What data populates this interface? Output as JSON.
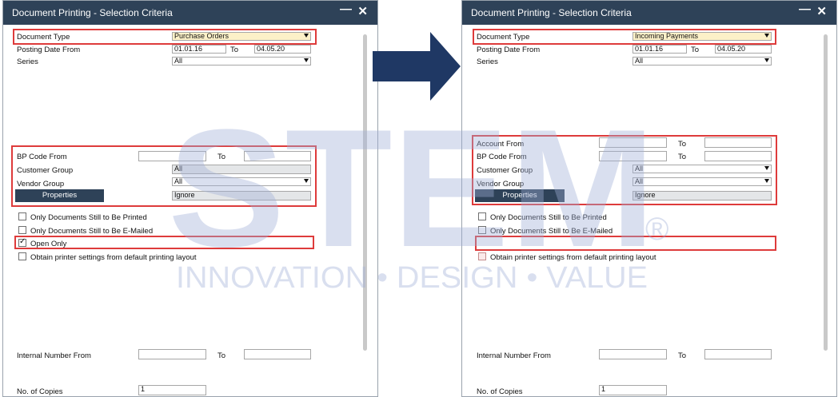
{
  "windows": [
    {
      "title": "Document Printing - Selection Criteria",
      "document_type": {
        "label": "Document Type",
        "value": "Purchase Orders"
      },
      "posting_date": {
        "label": "Posting Date From",
        "from": "01.01.16",
        "to_label": "To",
        "to": "04.05.20"
      },
      "series": {
        "label": "Series",
        "value": "All"
      },
      "account_from": null,
      "bp_code": {
        "label": "BP Code From",
        "from": "",
        "to_label": "To",
        "to": ""
      },
      "customer_group": {
        "label": "Customer Group",
        "value": "All"
      },
      "vendor_group": {
        "label": "Vendor Group",
        "value": "All"
      },
      "properties": {
        "button": "Properties",
        "value": "Ignore"
      },
      "checks": [
        {
          "label": "Only Documents Still to Be Printed",
          "checked": false
        },
        {
          "label": "Only Documents Still to Be E-Mailed",
          "checked": false
        },
        {
          "label": "Open Only",
          "checked": true
        },
        {
          "label": "Obtain printer settings from default printing layout",
          "checked": false
        }
      ],
      "internal_number": {
        "label": "Internal Number From",
        "from": "",
        "to_label": "To",
        "to": ""
      },
      "copies": {
        "label": "No. of Copies",
        "value": "1"
      }
    },
    {
      "title": "Document Printing - Selection Criteria",
      "document_type": {
        "label": "Document Type",
        "value": "Incoming Payments"
      },
      "posting_date": {
        "label": "Posting Date From",
        "from": "01.01.16",
        "to_label": "To",
        "to": "04.05.20"
      },
      "series": {
        "label": "Series",
        "value": "All"
      },
      "account_from": {
        "label": "Account From",
        "from": "",
        "to_label": "To",
        "to": ""
      },
      "bp_code": {
        "label": "BP Code From",
        "from": "",
        "to_label": "To",
        "to": ""
      },
      "customer_group": {
        "label": "Customer Group",
        "value": "All"
      },
      "vendor_group": {
        "label": "Vendor Group",
        "value": "All"
      },
      "properties": {
        "button": "Properties",
        "value": "Ignore"
      },
      "checks": [
        {
          "label": "Only Documents Still to Be Printed",
          "checked": false
        },
        {
          "label": "Only Documents Still to Be E-Mailed",
          "checked": false
        },
        {
          "label": "Obtain printer settings from default printing layout",
          "checked": false
        }
      ],
      "internal_number": {
        "label": "Internal Number From",
        "from": "",
        "to_label": "To",
        "to": ""
      },
      "copies": {
        "label": "No. of Copies",
        "value": "1"
      }
    }
  ],
  "watermark": {
    "brand": "STEM",
    "registered": "®",
    "tagline": "INNOVATION • DESIGN • VALUE"
  },
  "colors": {
    "titlebar": "#2e4258",
    "highlight": "#de3b3b",
    "arrow": "#1f3864",
    "watermark": "#9fb0d8"
  }
}
